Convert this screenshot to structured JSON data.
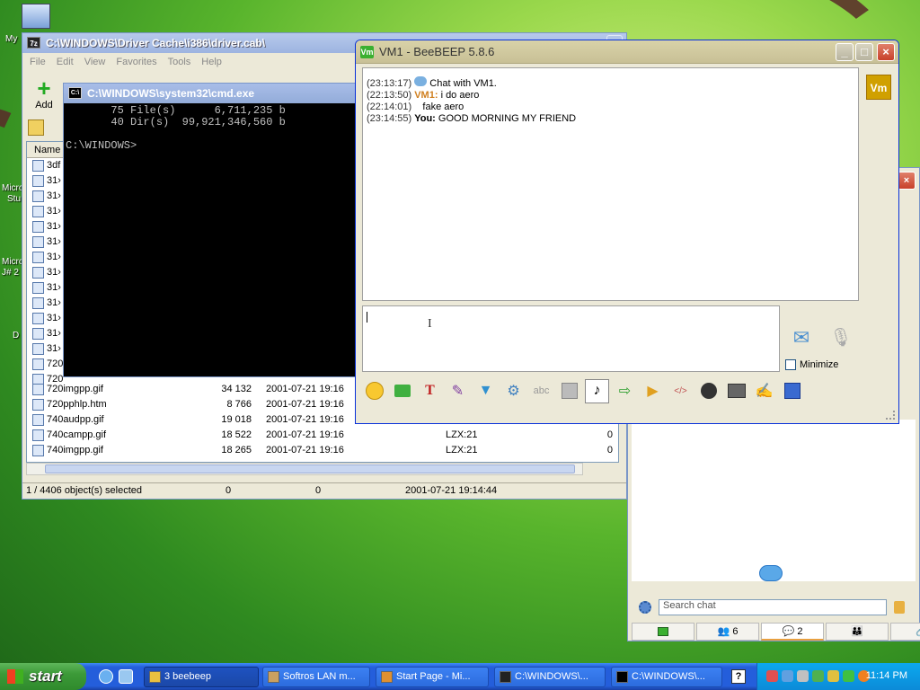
{
  "desktop": {
    "icon_labels": [
      "My",
      "Micro",
      "Stu",
      "Micro",
      "J# 2",
      "D"
    ]
  },
  "zip_window": {
    "title": "C:\\WINDOWS\\Driver Cache\\i386\\driver.cab\\",
    "menu": [
      "File",
      "Edit",
      "View",
      "Favorites",
      "Tools",
      "Help"
    ],
    "add_label": "Add",
    "name_header": "Name",
    "partial_rows": [
      "3df",
      "31›",
      "31›",
      "31›",
      "31›",
      "31›",
      "31›",
      "31›",
      "31›",
      "31›",
      "31›",
      "31›",
      "31›",
      "720",
      "720"
    ],
    "rows": [
      {
        "name": "720imgpp.gif",
        "size": "34 132",
        "date": "2001-07-21 19:16",
        "method": "",
        "extra": ""
      },
      {
        "name": "720pphlp.htm",
        "size": "8 766",
        "date": "2001-07-21 19:16",
        "method": "",
        "extra": ""
      },
      {
        "name": "740audpp.gif",
        "size": "19 018",
        "date": "2001-07-21 19:16",
        "method": "LZX:21",
        "extra": ""
      },
      {
        "name": "740campp.gif",
        "size": "18 522",
        "date": "2001-07-21 19:16",
        "method": "LZX:21",
        "extra": "0"
      },
      {
        "name": "740imgpp.gif",
        "size": "18 265",
        "date": "2001-07-21 19:16",
        "method": "LZX:21",
        "extra": "0"
      }
    ],
    "status": {
      "selected": "1 / 4406 object(s) selected",
      "s1": "0",
      "s2": "0",
      "modified": "2001-07-21 19:14:44"
    }
  },
  "cmd_window": {
    "title": "C:\\WINDOWS\\system32\\cmd.exe",
    "lines": [
      "       75 File(s)      6,711,235 b",
      "       40 Dir(s)  99,921,346,560 b",
      "",
      "C:\\WINDOWS>"
    ]
  },
  "beebeep": {
    "title": "VM1 - BeeBEEP 5.8.6",
    "title_icon": "Vm",
    "badge": "Vm",
    "chat": [
      {
        "time": "(23:13:17)",
        "sender": "",
        "text": "Chat with VM1."
      },
      {
        "time": "(22:13:50)",
        "sender": "VM1:",
        "text": "i do aero"
      },
      {
        "time": "(22:14:01)",
        "sender": "",
        "text": "fake aero"
      },
      {
        "time": "(23:14:55)",
        "sender": "You:",
        "text": "GOOD MORNING MY FRIEND"
      }
    ],
    "minimize_label": "Minimize",
    "accent": "#d0a000",
    "vm1_color": "#d08020"
  },
  "beebeep_side": {
    "search_placeholder": "Search chat",
    "tabs": [
      {
        "label": ""
      },
      {
        "label": "6"
      },
      {
        "label": "2"
      },
      {
        "label": ""
      },
      {
        "label": ""
      }
    ]
  },
  "taskbar": {
    "start_label": "start",
    "tasks": [
      {
        "label": "3 beebeep",
        "active": true
      },
      {
        "label": "Softros LAN m...",
        "active": false
      },
      {
        "label": "Start Page - Mi...",
        "active": false
      },
      {
        "label": "C:\\WINDOWS\\...",
        "active": false
      },
      {
        "label": "C:\\WINDOWS\\...",
        "active": false
      }
    ],
    "clock": "11:14 PM"
  }
}
